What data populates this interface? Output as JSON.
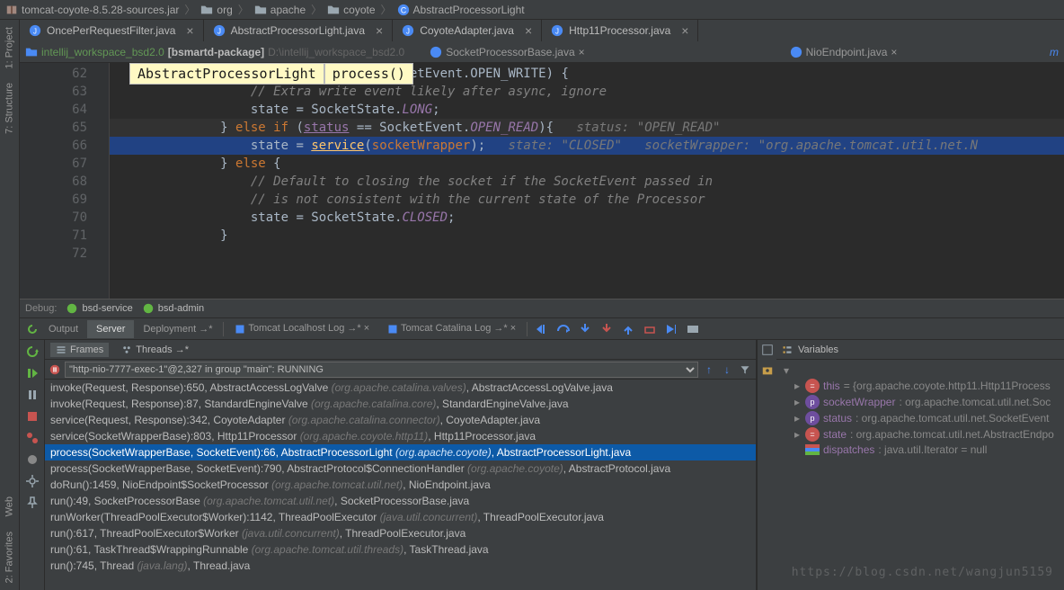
{
  "breadcrumbs": {
    "jar": "tomcat-coyote-8.5.28-sources.jar",
    "pkg1": "org",
    "pkg2": "apache",
    "pkg3": "coyote",
    "cls": "AbstractProcessorLight"
  },
  "side_tabs": {
    "project": "1: Project",
    "structure": "7: Structure",
    "favorites": "2: Favorites",
    "web": "Web"
  },
  "editor_tabs": [
    {
      "label": "OncePerRequestFilter.java",
      "closable": true
    },
    {
      "label": "AbstractProcessorLight.java",
      "closable": true
    },
    {
      "label": "CoyoteAdapter.java",
      "closable": true
    },
    {
      "label": "Http11Processor.java",
      "closable": true
    }
  ],
  "sub_crumb": {
    "ws": "intellij_workspace_bsd2.0",
    "pkg": "[bsmartd-package]",
    "path": "D:\\intellij_workspace_bsd2.0",
    "tab1": "SocketProcessorBase.java",
    "tab2": "NioEndpoint.java"
  },
  "tooltip": {
    "cls": "AbstractProcessorLight",
    "method": "process()"
  },
  "code": {
    "line62": "} else if (status == SocketEvent.OPEN_WRITE) {",
    "c63": "// Extra write event likely after async, ignore",
    "l64_a": "state",
    "l64_b": " = SocketState.",
    "l64_c": "LONG",
    "l64_d": ";",
    "l65_a": "} ",
    "l65_kw": "else if ",
    "l65_b": "(",
    "l65_status": "status",
    "l65_eq": " == SocketEvent.",
    "l65_c": "OPEN_READ",
    "l65_d": "){",
    "l65_inlay": "   status: \"OPEN_READ\"",
    "l66_a": "state",
    "l66_eq": " = ",
    "l66_m": "service",
    "l66_b": "(",
    "l66_p": "socketWrapper",
    "l66_c": ");",
    "l66_in1": "   state: \"CLOSED\"   socketWrapper: \"org.apache.tomcat.util.net.N",
    "l67": "} ",
    "l67_kw": "else ",
    "l67_b": "{",
    "c68": "// Default to closing the socket if the SocketEvent passed in",
    "c69": "// is not consistent with the current state of the Processor",
    "l70_a": "state",
    "l70_b": " = SocketState.",
    "l70_c": "CLOSED",
    "l70_d": ";",
    "l71": "}",
    "lines": [
      "62",
      "63",
      "64",
      "65",
      "66",
      "67",
      "68",
      "69",
      "70",
      "71",
      "72"
    ]
  },
  "debug": {
    "label": "Debug:",
    "configs": [
      "bsd-service",
      "bsd-admin"
    ],
    "tabs": {
      "output": "Output",
      "server": "Server",
      "deploy": "Deployment →*",
      "tlog": "Tomcat Localhost Log →* ×",
      "clog": "Tomcat Catalina Log →* ×"
    },
    "frames_tab": "Frames",
    "threads_tab": "Threads →*",
    "thread": "\"http-nio-7777-exec-1\"@2,327 in group \"main\": RUNNING",
    "frames": [
      {
        "sig": "invoke(Request, Response):650, AbstractAccessLogValve",
        "pkg": "(org.apache.catalina.valves)",
        "file": ", AbstractAccessLogValve.java"
      },
      {
        "sig": "invoke(Request, Response):87, StandardEngineValve",
        "pkg": "(org.apache.catalina.core)",
        "file": ", StandardEngineValve.java"
      },
      {
        "sig": "service(Request, Response):342, CoyoteAdapter",
        "pkg": "(org.apache.catalina.connector)",
        "file": ", CoyoteAdapter.java"
      },
      {
        "sig": "service(SocketWrapperBase):803, Http11Processor",
        "pkg": "(org.apache.coyote.http11)",
        "file": ", Http11Processor.java"
      },
      {
        "sig": "process(SocketWrapperBase, SocketEvent):66, AbstractProcessorLight",
        "pkg": "(org.apache.coyote)",
        "file": ", AbstractProcessorLight.java",
        "selected": true
      },
      {
        "sig": "process(SocketWrapperBase, SocketEvent):790, AbstractProtocol$ConnectionHandler",
        "pkg": "(org.apache.coyote)",
        "file": ", AbstractProtocol.java"
      },
      {
        "sig": "doRun():1459, NioEndpoint$SocketProcessor",
        "pkg": "(org.apache.tomcat.util.net)",
        "file": ", NioEndpoint.java"
      },
      {
        "sig": "run():49, SocketProcessorBase",
        "pkg": "(org.apache.tomcat.util.net)",
        "file": ", SocketProcessorBase.java"
      },
      {
        "sig": "runWorker(ThreadPoolExecutor$Worker):1142, ThreadPoolExecutor",
        "pkg": "(java.util.concurrent)",
        "file": ", ThreadPoolExecutor.java"
      },
      {
        "sig": "run():617, ThreadPoolExecutor$Worker",
        "pkg": "(java.util.concurrent)",
        "file": ", ThreadPoolExecutor.java"
      },
      {
        "sig": "run():61, TaskThread$WrappingRunnable",
        "pkg": "(org.apache.tomcat.util.threads)",
        "file": ", TaskThread.java"
      },
      {
        "sig": "run():745, Thread",
        "pkg": "(java.lang)",
        "file": ", Thread.java"
      }
    ],
    "vars_title": "Variables",
    "vars": [
      {
        "tw": "▸",
        "badge": "eq",
        "name": "this",
        "val": " = {org.apache.coyote.http11.Http11Process"
      },
      {
        "tw": "▸",
        "badge": "p",
        "name": "socketWrapper",
        "val": ": org.apache.tomcat.util.net.Soc"
      },
      {
        "tw": "▸",
        "badge": "p",
        "name": "status",
        "val": ": org.apache.tomcat.util.net.SocketEvent"
      },
      {
        "tw": "▸",
        "badge": "eq",
        "name": "state",
        "val": ": org.apache.tomcat.util.net.AbstractEndpo"
      },
      {
        "tw": "",
        "badge": "strip",
        "name": "dispatches",
        "val": ": java.util.Iterator  = null"
      }
    ]
  },
  "watermark": "https://blog.csdn.net/wangjun5159"
}
